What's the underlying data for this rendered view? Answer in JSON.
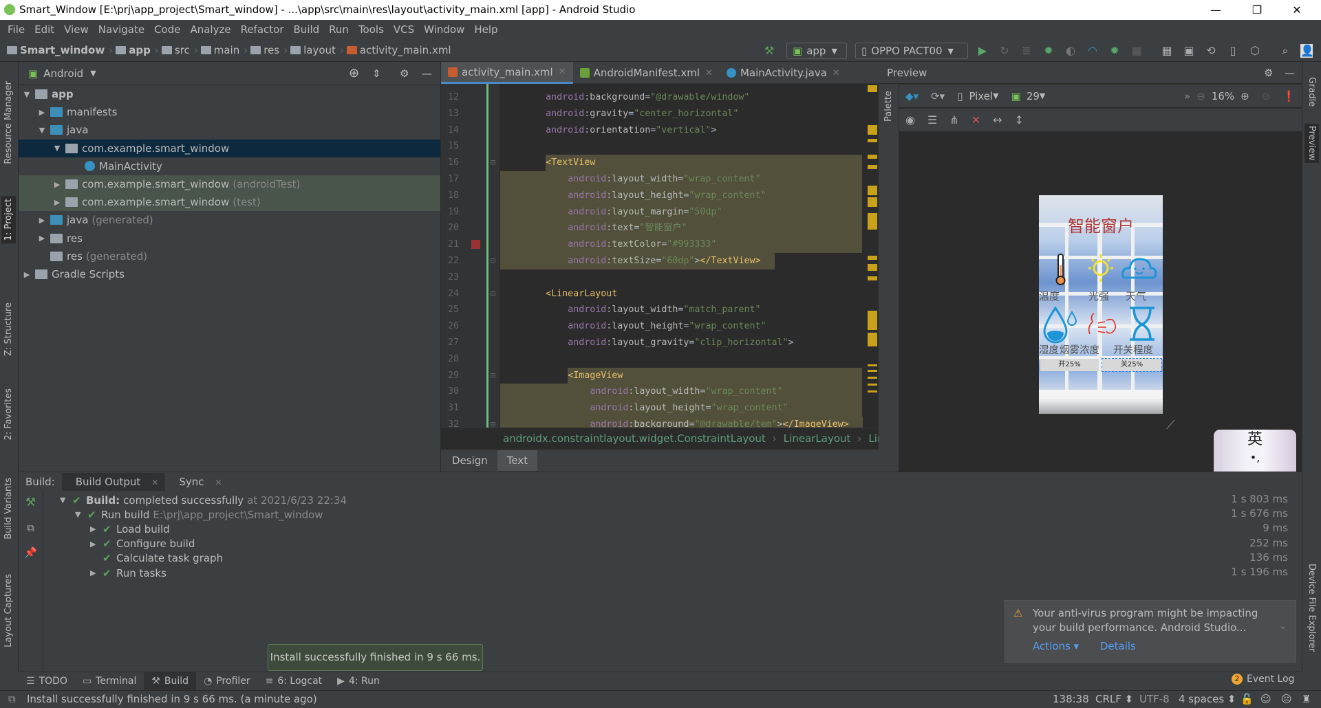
{
  "window": {
    "title": "Smart_Window [E:\\prj\\app_project\\Smart_window] - ...\\app\\src\\main\\res\\layout\\activity_main.xml [app] - Android Studio",
    "minimize": "—",
    "restore": "❐",
    "close": "✕"
  },
  "menu": [
    "File",
    "Edit",
    "View",
    "Navigate",
    "Code",
    "Analyze",
    "Refactor",
    "Build",
    "Run",
    "Tools",
    "VCS",
    "Window",
    "Help"
  ],
  "breadcrumb": [
    "Smart_window",
    "app",
    "src",
    "main",
    "res",
    "layout",
    "activity_main.xml"
  ],
  "toolbar": {
    "run_config": "app",
    "device": "OPPO PACT00"
  },
  "left_strip": [
    "Resource Manager",
    "1: Project",
    "Z: Structure",
    "2: Favorites",
    "Build Variants",
    "Layout Captures"
  ],
  "right_strip": [
    "Gradle",
    "Preview",
    "Device File Explorer"
  ],
  "project": {
    "view_mode": "Android",
    "tree": [
      {
        "label": "app",
        "level": 0,
        "arrow": "▼",
        "bold": true,
        "color": "#9aa3ab"
      },
      {
        "label": "manifests",
        "level": 1,
        "arrow": "▶",
        "color": "#3d8fb8"
      },
      {
        "label": "java",
        "level": 1,
        "arrow": "▼",
        "color": "#3d8fb8"
      },
      {
        "label": "com.example.smart_window",
        "level": 2,
        "arrow": "▼",
        "color": "#9aa3ab",
        "selected": true
      },
      {
        "label": "MainActivity",
        "level": 3,
        "arrow": "",
        "color": "#3592c4",
        "class": true
      },
      {
        "label": "com.example.smart_window",
        "suffix": "(androidTest)",
        "level": 2,
        "arrow": "▶",
        "color": "#9aa3ab",
        "test": true
      },
      {
        "label": "com.example.smart_window",
        "suffix": "(test)",
        "level": 2,
        "arrow": "▶",
        "color": "#9aa3ab",
        "test": true
      },
      {
        "label": "java",
        "suffix": "(generated)",
        "level": 1,
        "arrow": "▶",
        "color": "#3d8fb8"
      },
      {
        "label": "res",
        "level": 1,
        "arrow": "▶",
        "color": "#9aa3ab"
      },
      {
        "label": "res",
        "suffix": "(generated)",
        "level": 1,
        "arrow": "",
        "color": "#9aa3ab"
      },
      {
        "label": "Gradle Scripts",
        "level": 0,
        "arrow": "▶",
        "color": "#9aa3ab"
      }
    ]
  },
  "editor": {
    "tabs": [
      {
        "label": "activity_main.xml",
        "active": true,
        "color": "#c75c2e"
      },
      {
        "label": "AndroidManifest.xml",
        "active": false,
        "color": "#6a9f3a"
      },
      {
        "label": "MainActivity.java",
        "active": false,
        "color": "#3592c4"
      }
    ],
    "lines": [
      {
        "n": "12",
        "indent": 8,
        "tokens": [
          [
            "ns",
            "android"
          ],
          [
            "p",
            ":"
          ],
          [
            "attr",
            "background"
          ],
          [
            "p",
            "="
          ],
          [
            "val",
            "\"@drawable/window\""
          ]
        ]
      },
      {
        "n": "13",
        "indent": 8,
        "tokens": [
          [
            "ns",
            "android"
          ],
          [
            "p",
            ":"
          ],
          [
            "attr",
            "gravity"
          ],
          [
            "p",
            "="
          ],
          [
            "val",
            "\"center_horizontal\""
          ]
        ]
      },
      {
        "n": "14",
        "indent": 8,
        "tokens": [
          [
            "ns",
            "android"
          ],
          [
            "p",
            ":"
          ],
          [
            "attr",
            "orientation"
          ],
          [
            "p",
            "="
          ],
          [
            "val",
            "\"vertical\""
          ],
          [
            "p",
            ">"
          ]
        ]
      },
      {
        "n": "15",
        "indent": 0,
        "tokens": []
      },
      {
        "n": "16",
        "indent": 8,
        "hl": true,
        "tokens": [
          [
            "tag",
            "<TextView"
          ]
        ]
      },
      {
        "n": "17",
        "indent": 12,
        "hl": true,
        "tokens": [
          [
            "ns",
            "android"
          ],
          [
            "p",
            ":"
          ],
          [
            "attr",
            "layout_width"
          ],
          [
            "p",
            "="
          ],
          [
            "val",
            "\"wrap_content\""
          ]
        ]
      },
      {
        "n": "18",
        "indent": 12,
        "hl": true,
        "tokens": [
          [
            "ns",
            "android"
          ],
          [
            "p",
            ":"
          ],
          [
            "attr",
            "layout_height"
          ],
          [
            "p",
            "="
          ],
          [
            "val",
            "\"wrap_content\""
          ]
        ]
      },
      {
        "n": "19",
        "indent": 12,
        "hl": true,
        "tokens": [
          [
            "ns",
            "android"
          ],
          [
            "p",
            ":"
          ],
          [
            "attr",
            "layout_margin"
          ],
          [
            "p",
            "="
          ],
          [
            "val",
            "\"50dp\""
          ]
        ]
      },
      {
        "n": "20",
        "indent": 12,
        "hl": true,
        "tokens": [
          [
            "ns",
            "android"
          ],
          [
            "p",
            ":"
          ],
          [
            "attr",
            "text"
          ],
          [
            "p",
            "="
          ],
          [
            "val",
            "\"智能窗户\""
          ]
        ]
      },
      {
        "n": "21",
        "indent": 12,
        "hl": true,
        "swatch": "#993333",
        "tokens": [
          [
            "ns",
            "android"
          ],
          [
            "p",
            ":"
          ],
          [
            "attr",
            "textColor"
          ],
          [
            "p",
            "="
          ],
          [
            "val",
            "\"#993333\""
          ]
        ]
      },
      {
        "n": "22",
        "indent": 12,
        "hl": true,
        "tokens": [
          [
            "ns",
            "android"
          ],
          [
            "p",
            ":"
          ],
          [
            "attr",
            "textSize"
          ],
          [
            "p",
            "="
          ],
          [
            "val",
            "\"60dp\""
          ],
          [
            "p",
            ">"
          ],
          [
            "tag",
            "</TextView>"
          ]
        ]
      },
      {
        "n": "23",
        "indent": 0,
        "tokens": []
      },
      {
        "n": "24",
        "indent": 8,
        "tokens": [
          [
            "tag",
            "<LinearLayout"
          ]
        ]
      },
      {
        "n": "25",
        "indent": 12,
        "tokens": [
          [
            "ns",
            "android"
          ],
          [
            "p",
            ":"
          ],
          [
            "attr",
            "layout_width"
          ],
          [
            "p",
            "="
          ],
          [
            "val",
            "\"match_parent\""
          ]
        ]
      },
      {
        "n": "26",
        "indent": 12,
        "tokens": [
          [
            "ns",
            "android"
          ],
          [
            "p",
            ":"
          ],
          [
            "attr",
            "layout_height"
          ],
          [
            "p",
            "="
          ],
          [
            "val",
            "\"wrap_content\""
          ]
        ]
      },
      {
        "n": "27",
        "indent": 12,
        "tokens": [
          [
            "ns",
            "android"
          ],
          [
            "p",
            ":"
          ],
          [
            "attr",
            "layout_gravity"
          ],
          [
            "p",
            "="
          ],
          [
            "val",
            "\"clip_horizontal\""
          ],
          [
            "p",
            ">"
          ]
        ]
      },
      {
        "n": "28",
        "indent": 0,
        "tokens": []
      },
      {
        "n": "29",
        "indent": 12,
        "hl": true,
        "tokens": [
          [
            "tag",
            "<ImageView"
          ]
        ]
      },
      {
        "n": "30",
        "indent": 16,
        "hl": true,
        "tokens": [
          [
            "ns",
            "android"
          ],
          [
            "p",
            ":"
          ],
          [
            "attr",
            "layout_width"
          ],
          [
            "p",
            "="
          ],
          [
            "val",
            "\"wrap_content\""
          ]
        ]
      },
      {
        "n": "31",
        "indent": 16,
        "hl": true,
        "tokens": [
          [
            "ns",
            "android"
          ],
          [
            "p",
            ":"
          ],
          [
            "attr",
            "layout_height"
          ],
          [
            "p",
            "="
          ],
          [
            "val",
            "\"wrap_content\""
          ]
        ]
      },
      {
        "n": "32",
        "indent": 16,
        "hl": true,
        "tokens": [
          [
            "ns",
            "android"
          ],
          [
            "p",
            ":"
          ],
          [
            "attr",
            "background"
          ],
          [
            "p",
            "="
          ],
          [
            "val",
            "\"@drawable/tem\""
          ],
          [
            "p",
            ">"
          ],
          [
            "tag",
            "</ImageView>"
          ]
        ]
      }
    ],
    "path": [
      "androidx.constraintlayout.widget.ConstraintLayout",
      "LinearLayout",
      "Lin"
    ],
    "mode_tabs": [
      {
        "label": "Design",
        "active": false
      },
      {
        "label": "Text",
        "active": true
      }
    ]
  },
  "preview": {
    "title": "Preview",
    "palette_label": "Palette",
    "device": "Pixel",
    "api": "29",
    "zoom": "16%",
    "app": {
      "title": "智能窗户",
      "title_color": "#b03838",
      "labels_row1": [
        "温度",
        "光强",
        "天气"
      ],
      "labels_row2": [
        "湿度",
        "烟雾浓度",
        "开关程度"
      ],
      "open_button": "开25%",
      "close_button": "关25%"
    }
  },
  "ime": {
    "mode": "英"
  },
  "build": {
    "label": "Build:",
    "tabs": [
      {
        "label": "Build Output",
        "active": true
      },
      {
        "label": "Sync",
        "active": false
      }
    ],
    "rows": [
      {
        "level": 0,
        "arrow": "▼",
        "bold": "Build:",
        "text": "completed successfully",
        "extra": "at 2021/6/23 22:34",
        "time": "1 s 803 ms"
      },
      {
        "level": 1,
        "arrow": "▼",
        "text": "Run build",
        "extra": "E:\\prj\\app_project\\Smart_window",
        "time": "1 s 676 ms"
      },
      {
        "level": 2,
        "arrow": "▶",
        "text": "Load build",
        "time": "9 ms"
      },
      {
        "level": 2,
        "arrow": "▶",
        "text": "Configure build",
        "time": "252 ms"
      },
      {
        "level": 2,
        "arrow": "",
        "text": "Calculate task graph",
        "time": "136 ms"
      },
      {
        "level": 2,
        "arrow": "▶",
        "text": "Run tasks",
        "time": "1 s 196 ms"
      }
    ]
  },
  "tooltip": "Install successfully finished in 9 s 66 ms.",
  "notification": {
    "text1": "Your anti-virus program might be impacting",
    "text2": "your build performance. Android Studio...",
    "actions": "Actions ▾",
    "details": "Details"
  },
  "bottom_tabs": [
    {
      "label": "TODO",
      "icon": "☰"
    },
    {
      "label": "Terminal",
      "icon": "▭"
    },
    {
      "label": "Build",
      "icon": "⚒",
      "active": true
    },
    {
      "label": "Profiler",
      "icon": "◔"
    },
    {
      "label": "6: Logcat",
      "icon": "≡"
    },
    {
      "label": "4: Run",
      "icon": "▶"
    }
  ],
  "event_log": {
    "label": "Event Log",
    "count": "2"
  },
  "status": {
    "message": "Install successfully finished in 9 s 66 ms. (a minute ago)",
    "position": "138:38",
    "line_sep": "CRLF ⬍",
    "encoding": "UTF-8",
    "indent": "4 spaces ⬍"
  }
}
